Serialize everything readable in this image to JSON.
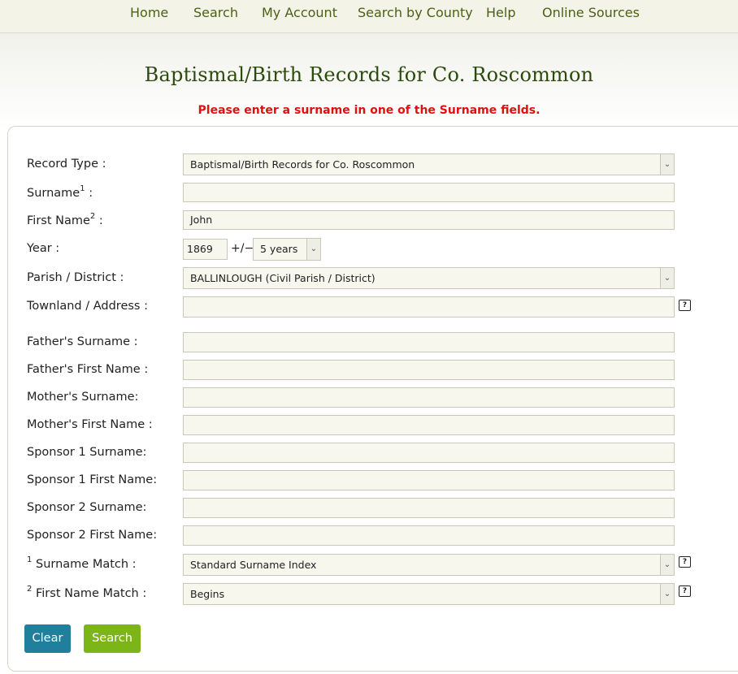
{
  "nav": {
    "items": [
      "Home",
      "Search",
      "My Account",
      "Search by County",
      "Help",
      "Online Sources"
    ]
  },
  "header": {
    "title": "Baptismal/Birth Records for Co. Roscommon",
    "error": "Please enter a surname in one of the Surname fields."
  },
  "form": {
    "record_type": {
      "label": "Record Type :",
      "value": "Baptismal/Birth Records for Co. Roscommon"
    },
    "surname": {
      "label": "Surname",
      "sup": "1",
      "colon": " :",
      "value": ""
    },
    "first_name": {
      "label": "First Name",
      "sup": "2",
      "colon": " :",
      "value": "John"
    },
    "year": {
      "label": "Year :",
      "value": "1869",
      "plusminus": "+/−",
      "range": "5 years"
    },
    "parish": {
      "label": "Parish / District :",
      "value": "BALLINLOUGH (Civil Parish / District)"
    },
    "townland": {
      "label": "Townland / Address :",
      "value": ""
    },
    "father_surname": {
      "label": "Father's Surname :",
      "value": ""
    },
    "father_first": {
      "label": "Father's First Name :",
      "value": ""
    },
    "mother_surname": {
      "label": "Mother's Surname:",
      "value": ""
    },
    "mother_first": {
      "label": "Mother's First Name :",
      "value": ""
    },
    "sponsor1_surname": {
      "label": "Sponsor 1 Surname:",
      "value": ""
    },
    "sponsor1_first": {
      "label": "Sponsor 1 First Name:",
      "value": ""
    },
    "sponsor2_surname": {
      "label": "Sponsor 2 Surname:",
      "value": ""
    },
    "sponsor2_first": {
      "label": "Sponsor 2 First Name:",
      "value": ""
    },
    "surname_match": {
      "sup": "1",
      "label": " Surname Match :",
      "value": "Standard Surname Index"
    },
    "first_match": {
      "sup": "2",
      "label": " First Name Match :",
      "value": "Begins"
    }
  },
  "buttons": {
    "clear": "Clear",
    "search": "Search"
  },
  "icons": {
    "help": "help-icon",
    "dropdown": "chevron-down-icon"
  },
  "colors": {
    "nav_text": "#4a6114",
    "title": "#2d4a0e",
    "error": "#e01010",
    "clear_btn": "#1f7f9c",
    "search_btn": "#7cb518"
  }
}
